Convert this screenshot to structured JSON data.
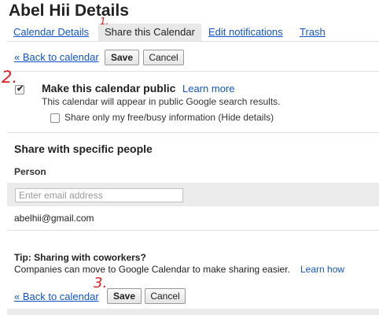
{
  "page": {
    "title": "Abel Hii Details"
  },
  "tabs": [
    {
      "label": "Calendar Details",
      "active": false
    },
    {
      "label": "Share this Calendar",
      "active": true
    },
    {
      "label": "Edit notifications",
      "active": false
    },
    {
      "label": "Trash",
      "active": false
    }
  ],
  "toolbar": {
    "back_label": "« Back to calendar",
    "save_label": "Save",
    "cancel_label": "Cancel"
  },
  "public": {
    "label": "Make this calendar public",
    "learn_more": "Learn more",
    "desc": "This calendar will appear in public Google search results.",
    "checked": true,
    "freebusy_label": "Share only my free/busy information (Hide details)",
    "freebusy_checked": false
  },
  "specific": {
    "heading": "Share with specific people",
    "person_header": "Person",
    "email_placeholder": "Enter email address",
    "people": [
      "abelhii@gmail.com"
    ]
  },
  "tip": {
    "heading": "Tip: Sharing with coworkers?",
    "text": "Companies can move to Google Calendar to make sharing easier.",
    "learn_how": "Learn how"
  },
  "annotations": [
    "1.",
    "2.",
    "3."
  ],
  "colors": {
    "link": "#1155cc",
    "annotation": "#e02020",
    "band": "#ebebeb"
  }
}
